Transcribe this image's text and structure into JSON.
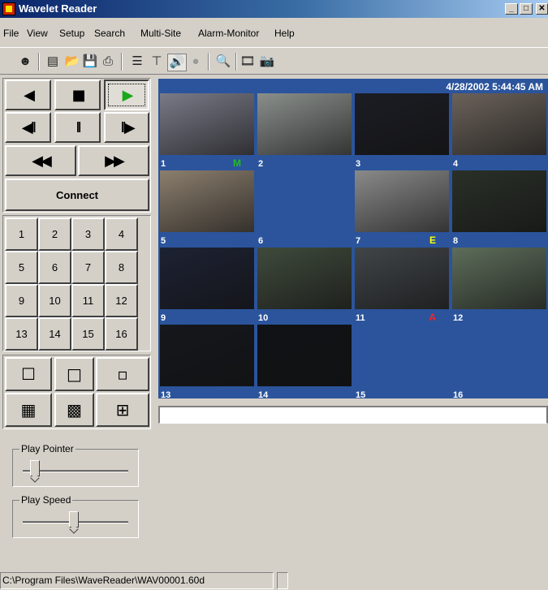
{
  "window": {
    "title": "Wavelet Reader",
    "minimize": "_",
    "maximize": "□",
    "close": "✕"
  },
  "menu": [
    "File",
    "View",
    "Setup",
    "Search",
    "Multi-Site",
    "Alarm-Monitor",
    "Help"
  ],
  "toolbar": [
    {
      "icon": "connect-icon",
      "glyph": "☻"
    },
    {
      "icon": "notepad-icon",
      "glyph": "▤"
    },
    {
      "icon": "open-folder-icon",
      "glyph": "📂"
    },
    {
      "icon": "save-icon",
      "glyph": "💾"
    },
    {
      "icon": "print-icon",
      "glyph": "⎙"
    },
    {
      "icon": "sequence-icon",
      "glyph": "☰"
    },
    {
      "icon": "filter-icon",
      "glyph": "⊤"
    },
    {
      "icon": "audio-icon",
      "glyph": "🔊"
    },
    {
      "icon": "record-icon",
      "glyph": "●"
    },
    {
      "icon": "search-globe-icon",
      "glyph": "🔍"
    },
    {
      "icon": "film-icon",
      "glyph": "🎞"
    },
    {
      "icon": "camera-icon",
      "glyph": "📷"
    }
  ],
  "controls": {
    "prev": "◀",
    "stop": "■",
    "play": "▶",
    "step_back": "◀II",
    "pause": "II",
    "step_forward": "II▶",
    "rewind": "◀◀",
    "fast_forward": "▶▶",
    "connect": "Connect"
  },
  "channels": [
    "1",
    "2",
    "3",
    "4",
    "5",
    "6",
    "7",
    "8",
    "9",
    "10",
    "11",
    "12",
    "13",
    "14",
    "15",
    "16"
  ],
  "layout_buttons": [
    {
      "name": "single-large-view-icon",
      "glyph": "☐"
    },
    {
      "name": "single-medium-view-icon",
      "glyph": "□"
    },
    {
      "name": "single-small-view-icon",
      "glyph": "▫"
    },
    {
      "name": "grid-16-view-icon",
      "glyph": "▦"
    },
    {
      "name": "grid-9-view-icon",
      "glyph": "▩"
    },
    {
      "name": "grid-4-view-icon",
      "glyph": "⊞"
    }
  ],
  "play_pointer": {
    "label": "Play Pointer",
    "value": 0.08
  },
  "play_speed": {
    "label": "Play Speed",
    "value": 0.48
  },
  "video": {
    "timestamp": "4/28/2002 5:44:45 AM",
    "cells": [
      {
        "num": "1",
        "flag": "M",
        "flag_color": "#22bb22",
        "bg": "#7a7a88"
      },
      {
        "num": "2",
        "flag": "",
        "flag_color": "",
        "bg": "#8a8f8c"
      },
      {
        "num": "3",
        "flag": "",
        "flag_color": "",
        "bg": "#1c1d24"
      },
      {
        "num": "4",
        "flag": "",
        "flag_color": "",
        "bg": "#6b625a"
      },
      {
        "num": "5",
        "flag": "",
        "flag_color": "",
        "bg": "#8c7f6e"
      },
      {
        "num": "6",
        "flag": "",
        "flag_color": "",
        "bg": ""
      },
      {
        "num": "7",
        "flag": "E",
        "flag_color": "#ffff00",
        "bg": "#8a8a8a"
      },
      {
        "num": "8",
        "flag": "",
        "flag_color": "",
        "bg": "#2a3028"
      },
      {
        "num": "9",
        "flag": "",
        "flag_color": "",
        "bg": "#1d2233"
      },
      {
        "num": "10",
        "flag": "",
        "flag_color": "",
        "bg": "#3f4a3c"
      },
      {
        "num": "11",
        "flag": "A",
        "flag_color": "#ff2020",
        "bg": "#404548"
      },
      {
        "num": "12",
        "flag": "",
        "flag_color": "",
        "bg": "#5d6d5a"
      },
      {
        "num": "13",
        "flag": "",
        "flag_color": "",
        "bg": "#15171c"
      },
      {
        "num": "14",
        "flag": "",
        "flag_color": "",
        "bg": "#101216"
      },
      {
        "num": "15",
        "flag": "",
        "flag_color": "",
        "bg": ""
      },
      {
        "num": "16",
        "flag": "",
        "flag_color": "",
        "bg": ""
      }
    ],
    "address_value": ""
  },
  "status": {
    "path": "C:\\Program Files\\WaveReader\\WAV00001.60d",
    "extra": ""
  }
}
